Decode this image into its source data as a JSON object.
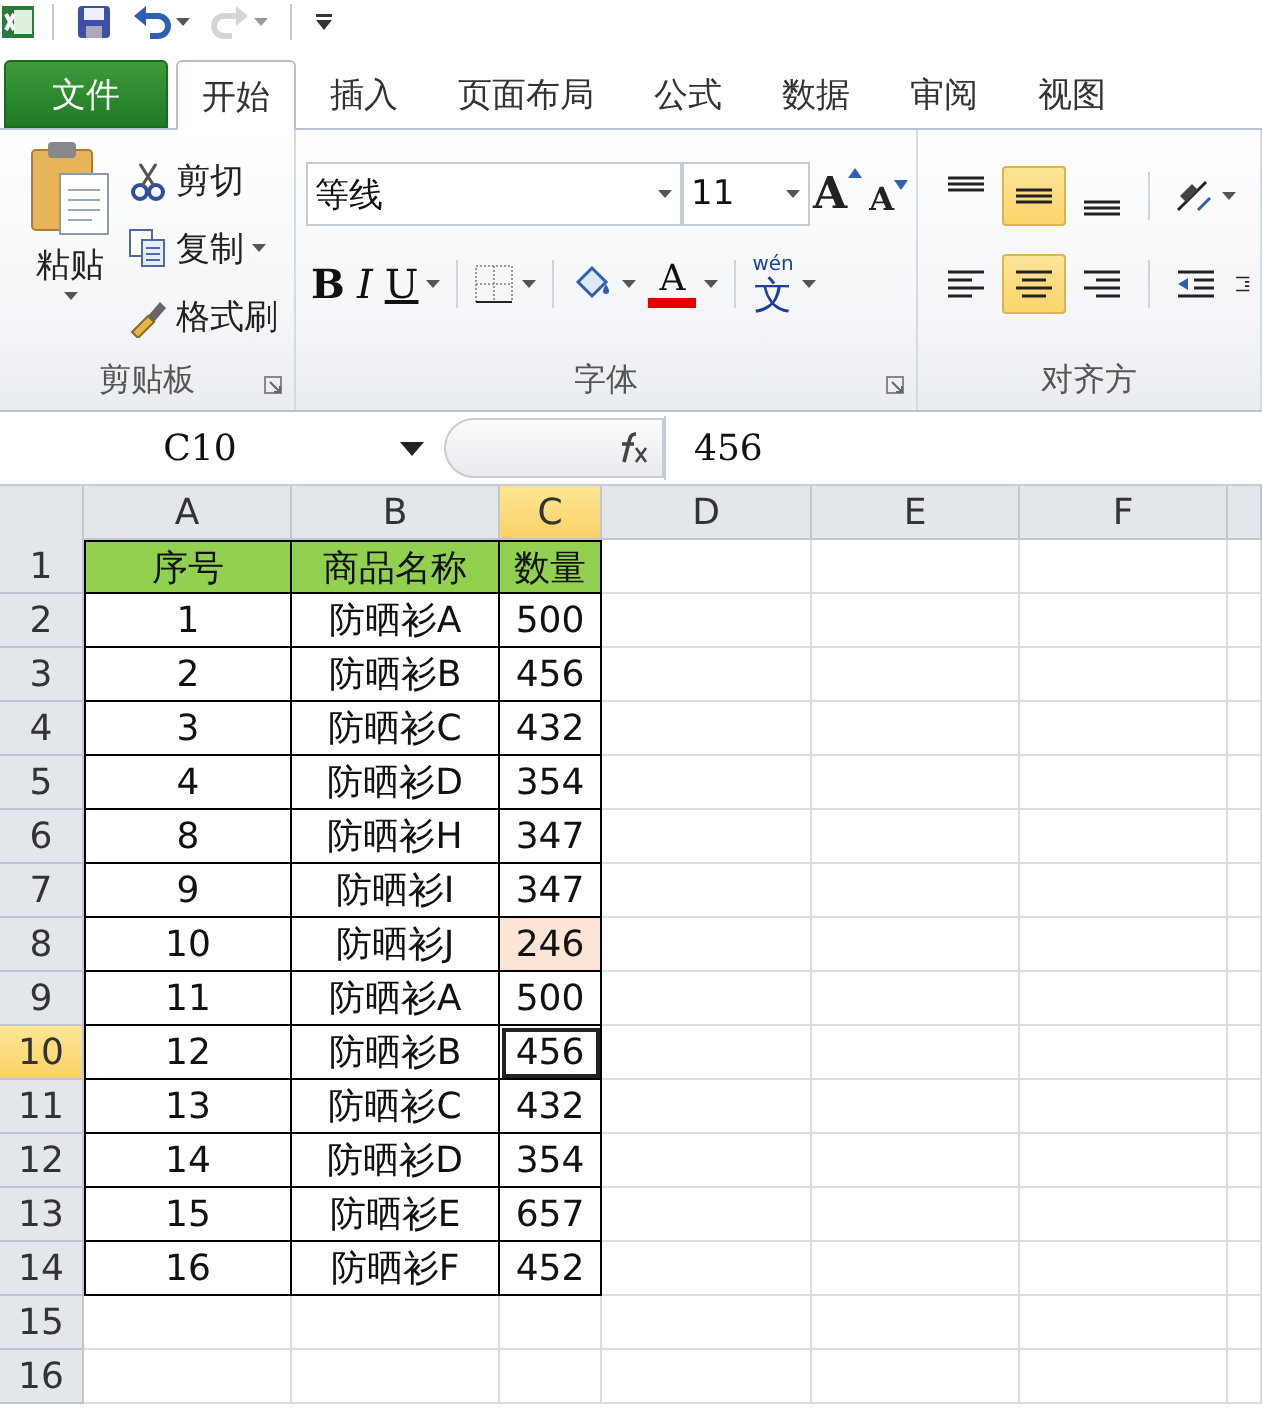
{
  "quick_access": [
    {
      "kind": "app"
    },
    {
      "kind": "save",
      "disabled": false
    },
    {
      "kind": "undo",
      "disabled": false
    },
    {
      "kind": "redo",
      "disabled": true
    },
    {
      "kind": "customize",
      "disabled": false
    }
  ],
  "file_tab": {
    "label": "文件"
  },
  "tabs": [
    {
      "label": "开始",
      "selected": true
    },
    {
      "label": "插入",
      "selected": false
    },
    {
      "label": "页面布局",
      "selected": false
    },
    {
      "label": "公式",
      "selected": false
    },
    {
      "label": "数据",
      "selected": false
    },
    {
      "label": "审阅",
      "selected": false
    },
    {
      "label": "视图",
      "selected": false
    }
  ],
  "clipboard": {
    "label": "剪贴板",
    "paste": "粘贴",
    "buttons": [
      {
        "kind": "cut",
        "label": "剪切",
        "dropdown": false
      },
      {
        "kind": "copy",
        "label": "复制",
        "dropdown": true
      },
      {
        "kind": "painter",
        "label": "格式刷",
        "dropdown": false
      }
    ]
  },
  "font": {
    "label": "字体",
    "font_name": "等线",
    "font_size": "11",
    "grow": "A",
    "shrink": "A",
    "bold": "B",
    "italic": "I",
    "underline": "U",
    "font_color": "A",
    "phonetic_top": "wén",
    "phonetic": "文"
  },
  "alignment": {
    "label": "对齐方",
    "buttons": [
      {
        "kind": "top",
        "selected": false
      },
      {
        "kind": "middle",
        "selected": true
      },
      {
        "kind": "bottom",
        "selected": false
      },
      {
        "kind": "orient",
        "selected": false
      },
      {
        "kind": "left",
        "selected": false
      },
      {
        "kind": "center",
        "selected": true
      },
      {
        "kind": "right",
        "selected": false
      },
      {
        "kind": "outdent",
        "selected": false
      },
      {
        "kind": "indent",
        "selected": false
      }
    ]
  },
  "formula_bar": {
    "name_box": "C10",
    "formula": "456"
  },
  "columns": [
    {
      "label": "A",
      "selected": false
    },
    {
      "label": "B",
      "selected": false
    },
    {
      "label": "C",
      "selected": true
    },
    {
      "label": "D",
      "selected": false
    },
    {
      "label": "E",
      "selected": false
    },
    {
      "label": "F",
      "selected": false
    }
  ],
  "rows": [
    {
      "number": "1",
      "selected": false,
      "cells": [
        {
          "text": "序号",
          "color": "#92d050",
          "selected": false
        },
        {
          "text": "商品名称",
          "color": "#92d050",
          "selected": false
        },
        {
          "text": "数量",
          "color": "#92d050",
          "selected": false
        }
      ]
    },
    {
      "number": "2",
      "selected": false,
      "cells": [
        {
          "text": "1",
          "selected": false
        },
        {
          "text": "防晒衫A",
          "selected": false
        },
        {
          "text": "500",
          "selected": false
        }
      ]
    },
    {
      "number": "3",
      "selected": false,
      "cells": [
        {
          "text": "2",
          "selected": false
        },
        {
          "text": "防晒衫B",
          "selected": false
        },
        {
          "text": "456",
          "selected": false
        }
      ]
    },
    {
      "number": "4",
      "selected": false,
      "cells": [
        {
          "text": "3",
          "selected": false
        },
        {
          "text": "防晒衫C",
          "selected": false
        },
        {
          "text": "432",
          "selected": false
        }
      ]
    },
    {
      "number": "5",
      "selected": false,
      "cells": [
        {
          "text": "4",
          "selected": false
        },
        {
          "text": "防晒衫D",
          "selected": false
        },
        {
          "text": "354",
          "selected": false
        }
      ]
    },
    {
      "number": "6",
      "selected": false,
      "cells": [
        {
          "text": "8",
          "selected": false
        },
        {
          "text": "防晒衫H",
          "selected": false
        },
        {
          "text": "347",
          "selected": false
        }
      ]
    },
    {
      "number": "7",
      "selected": false,
      "cells": [
        {
          "text": "9",
          "selected": false
        },
        {
          "text": "防晒衫I",
          "selected": false
        },
        {
          "text": "347",
          "selected": false
        }
      ]
    },
    {
      "number": "8",
      "selected": false,
      "cells": [
        {
          "text": "10",
          "selected": false
        },
        {
          "text": "防晒衫J",
          "selected": false
        },
        {
          "text": "246",
          "color": "#fce4d6",
          "selected": false
        }
      ]
    },
    {
      "number": "9",
      "selected": false,
      "cells": [
        {
          "text": "11",
          "selected": false
        },
        {
          "text": "防晒衫A",
          "selected": false
        },
        {
          "text": "500",
          "selected": false
        }
      ]
    },
    {
      "number": "10",
      "selected": true,
      "cells": [
        {
          "text": "12",
          "selected": false
        },
        {
          "text": "防晒衫B",
          "selected": false
        },
        {
          "text": "456",
          "selected": true
        }
      ]
    },
    {
      "number": "11",
      "selected": false,
      "cells": [
        {
          "text": "13",
          "selected": false
        },
        {
          "text": "防晒衫C",
          "selected": false
        },
        {
          "text": "432",
          "selected": false
        }
      ]
    },
    {
      "number": "12",
      "selected": false,
      "cells": [
        {
          "text": "14",
          "selected": false
        },
        {
          "text": "防晒衫D",
          "selected": false
        },
        {
          "text": "354",
          "selected": false
        }
      ]
    },
    {
      "number": "13",
      "selected": false,
      "cells": [
        {
          "text": "15",
          "selected": false
        },
        {
          "text": "防晒衫E",
          "selected": false
        },
        {
          "text": "657",
          "selected": false
        }
      ]
    },
    {
      "number": "14",
      "selected": false,
      "cells": [
        {
          "text": "16",
          "selected": false
        },
        {
          "text": "防晒衫F",
          "selected": false
        },
        {
          "text": "452",
          "selected": false
        }
      ]
    },
    {
      "number": "15",
      "selected": false
    },
    {
      "number": "16",
      "selected": false
    }
  ]
}
